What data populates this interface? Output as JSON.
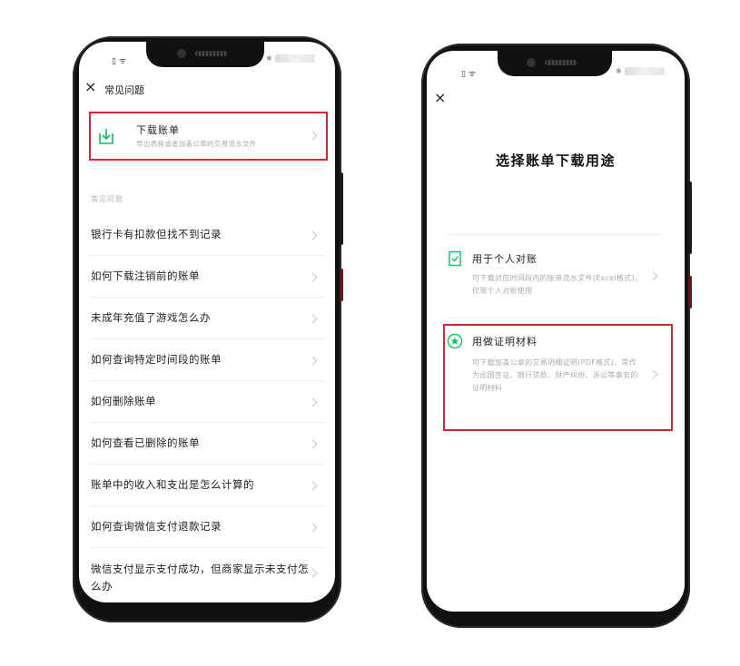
{
  "colors": {
    "accent": "#07c160",
    "highlight": "#d9262c"
  },
  "left_phone": {
    "status": {
      "left_icons": "▯ ᯤ",
      "right_icon": "✱"
    },
    "header": {
      "close_icon": "close-icon",
      "close_symbol": "×",
      "title": "常见问题"
    },
    "download_card": {
      "icon": "download-icon",
      "title": "下载账单",
      "subtitle": "导出表格或者加盖公章的交易流水文件"
    },
    "section_label": "常见问题",
    "faq_items": [
      "银行卡有扣款但找不到记录",
      "如何下载注销前的账单",
      "未成年充值了游戏怎么办",
      "如何查询特定时间段的账单",
      "如何删除账单",
      "如何查看已删除的账单",
      "账单中的收入和支出是怎么计算的",
      "如何查询微信支付退款记录",
      "微信支付显示支付成功，但商家显示未支付怎么办"
    ]
  },
  "right_phone": {
    "status": {
      "left_icons": "▯ ᯤ",
      "right_icon": "✱"
    },
    "close_symbol": "×",
    "title": "选择账单下载用途",
    "options": [
      {
        "icon": "document-check-icon",
        "title": "用于个人对账",
        "description": "可下载对应时间段内的账单流水文件(Excel格式)，仅限个人对账使用"
      },
      {
        "icon": "certificate-badge-icon",
        "title": "用做证明材料",
        "description": "可下载加盖公章的交易明细证明(PDF格式)，常作为出国签证、银行贷款、财产纠纷、诉讼等事务的证明材料"
      }
    ]
  }
}
